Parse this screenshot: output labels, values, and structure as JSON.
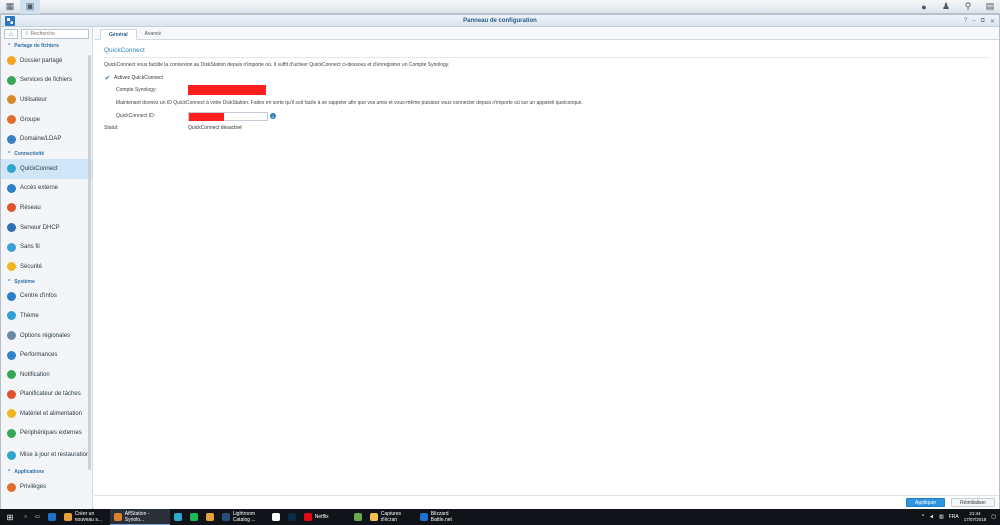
{
  "window": {
    "title": "Panneau de configuration"
  },
  "sidebar": {
    "search_placeholder": "Recherche",
    "sections": [
      {
        "label": "Partage de fichiers",
        "items": [
          {
            "label": "Dossier partagé",
            "icon": "folder-icon",
            "color": "#f2a623"
          },
          {
            "label": "Services de fichiers",
            "icon": "file-services-icon",
            "color": "#3aa655"
          },
          {
            "label": "Utilisateur",
            "icon": "user-icon",
            "color": "#d98a2b"
          },
          {
            "label": "Groupe",
            "icon": "group-icon",
            "color": "#e26d2b"
          },
          {
            "label": "Domaine/LDAP",
            "icon": "domain-icon",
            "color": "#3a7fc4"
          }
        ]
      },
      {
        "label": "Connectivité",
        "items": [
          {
            "label": "QuickConnect",
            "icon": "quickconnect-icon",
            "color": "#2fa7c9",
            "selected": true
          },
          {
            "label": "Accès externe",
            "icon": "globe-icon",
            "color": "#2a7fc8"
          },
          {
            "label": "Réseau",
            "icon": "network-icon",
            "color": "#e0542b"
          },
          {
            "label": "Serveur DHCP",
            "icon": "dhcp-icon",
            "color": "#2f6fb5"
          },
          {
            "label": "Sans fil",
            "icon": "wifi-icon",
            "color": "#3aa0d8"
          },
          {
            "label": "Sécurité",
            "icon": "shield-icon",
            "color": "#f2b41c"
          }
        ]
      },
      {
        "label": "Système",
        "items": [
          {
            "label": "Centre d'infos",
            "icon": "info-icon",
            "color": "#2a7fc8"
          },
          {
            "label": "Thème",
            "icon": "theme-icon",
            "color": "#2fa0d8"
          },
          {
            "label": "Options régionales",
            "icon": "region-icon",
            "color": "#6b8aa8"
          },
          {
            "label": "Performances",
            "icon": "performance-icon",
            "color": "#2f83c9"
          },
          {
            "label": "Notification",
            "icon": "notification-icon",
            "color": "#3aa655"
          },
          {
            "label": "Planificateur de tâches",
            "icon": "calendar-icon",
            "color": "#e0542b"
          },
          {
            "label": "Matériel et alimentation",
            "icon": "bulb-icon",
            "color": "#f2b41c"
          },
          {
            "label": "Périphériques externes",
            "icon": "external-device-icon",
            "color": "#3aa655"
          },
          {
            "label": "Mise à jour et restauration",
            "icon": "update-icon",
            "color": "#2fa7c9",
            "tall": true
          }
        ]
      },
      {
        "label": "Applications",
        "items": [
          {
            "label": "Privilèges",
            "icon": "privileges-icon",
            "color": "#e26d2b"
          }
        ]
      }
    ]
  },
  "tabs": [
    {
      "label": "Général",
      "active": true
    },
    {
      "label": "Avancé",
      "active": false
    }
  ],
  "main": {
    "title": "QuickConnect",
    "intro": "QuickConnect vous facilite la connexion au DiskStation depuis n'importe où. Il suffit d'activer QuickConnect ci-dessous et d'enregistrer un Compte Synology.",
    "enable_label": "Activez QuickConnect",
    "account_label": "Compte Synology:",
    "id_hint": "Maintenant donnez un ID QuickConnect à votre DiskStation. Faites en sorte qu'il soit facile à se rappeler afin que vos amis et vous-même puissiez vous connecter depuis n'importe où sur un appareil quelconque.",
    "id_label": "QuickConnect ID:",
    "status_label": "Statut:",
    "status_value": "QuickConnect désactivé"
  },
  "buttons": {
    "apply": "Appliquer",
    "reset": "Réinitialiser"
  },
  "taskbar": {
    "apps": [
      {
        "label": "Créer un nouveau s...",
        "color": "#e8a13a"
      },
      {
        "label": "AffStation - Synolo...",
        "color": "#d9822b",
        "active": true
      },
      {
        "label": "Lightroom Catalog ...",
        "color": "#2b4d7a"
      },
      {
        "label": "Netflix",
        "color": "#e50914"
      },
      {
        "label": "Captures d'écran",
        "color": "#f2c14e"
      },
      {
        "label": "Blizzard Battle.net",
        "color": "#1d6fd1"
      }
    ],
    "lang": "FRA",
    "time": "21:44",
    "date": "17/07/2018"
  }
}
